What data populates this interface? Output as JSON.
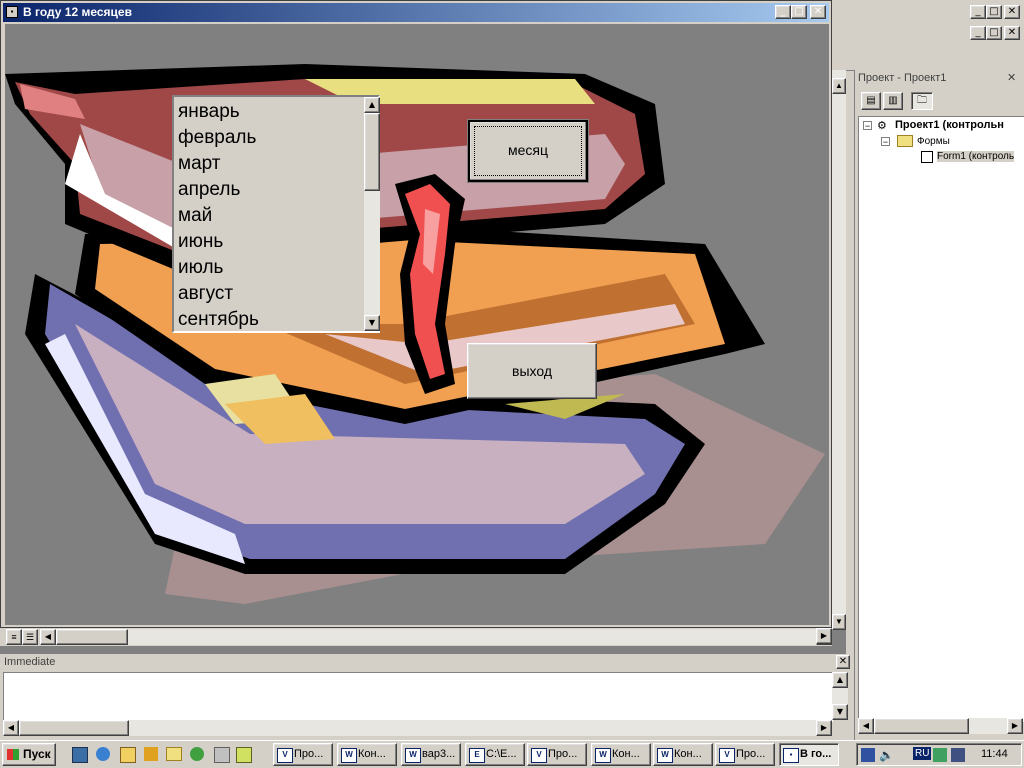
{
  "form_window": {
    "title": "В году  12 месяцев",
    "min": "_",
    "max": "□",
    "close": "✕"
  },
  "listbox": {
    "items": [
      "январь",
      "февраль",
      "март",
      "апрель",
      "май",
      "июнь",
      "июль",
      "август",
      "сентябрь"
    ]
  },
  "buttons": {
    "month": "месяц",
    "exit": "выход"
  },
  "mdi_controls": {
    "min": "_",
    "max": "□",
    "close": "✕"
  },
  "project": {
    "title": "Проект - Проект1",
    "close": "✕",
    "root": "Проект1 (контрольн",
    "folder": "Формы",
    "form": "Form1 (контроль"
  },
  "immediate": {
    "title": "Immediate",
    "close": "✕"
  },
  "taskbar": {
    "start": "Пуск",
    "tasks": [
      "Про...",
      "Кон...",
      "вар3...",
      "C:\\E...",
      "Про...",
      "Кон...",
      "Кон...",
      "Про...",
      "В го..."
    ],
    "time": "11:44",
    "lang": "RU"
  },
  "colors": {
    "titlebar": "#0a246a",
    "desktop": "#808080",
    "face": "#d4d0c8"
  }
}
